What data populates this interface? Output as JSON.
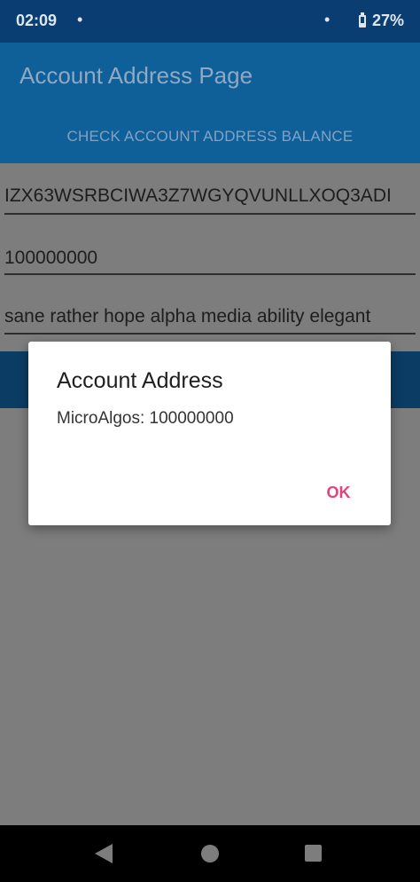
{
  "status_bar": {
    "time": "02:09",
    "dot": "•",
    "battery_percent": "27%",
    "battery_icon": "battery-icon"
  },
  "app_bar": {
    "title": "Account Address Page"
  },
  "actions": {
    "check_balance_label": "CHECK ACCOUNT ADDRESS BALANCE"
  },
  "form": {
    "address_value": "IZX63WSRBCIWA3Z7WGYQVUNLLXOQ3ADI",
    "amount_value": "100000000",
    "mnemonic_value": "sane rather hope alpha media ability elegant"
  },
  "dialog": {
    "title": "Account Address",
    "message": "MicroAlgos: 100000000",
    "ok_label": "OK"
  },
  "nav_bar": {
    "icons": [
      "back-icon",
      "home-icon",
      "recents-icon"
    ]
  },
  "colors": {
    "status_bar": "#0a3d72",
    "app_bar": "#0f5f98",
    "scrim_background": "#7d7d7d",
    "dialog_accent": "#e0437d"
  }
}
